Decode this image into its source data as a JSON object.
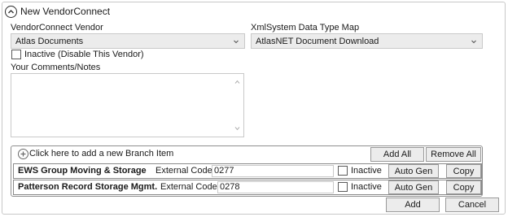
{
  "header": {
    "title": "New VendorConnect"
  },
  "vendor": {
    "label": "VendorConnect Vendor",
    "selected": "Atlas Documents"
  },
  "datatype": {
    "label": "XmlSystem Data Type Map",
    "selected": "AtlasNET Document Download"
  },
  "inactive": {
    "label": "Inactive (Disable This Vendor)",
    "checked": false
  },
  "comments": {
    "label": "Your Comments/Notes",
    "value": ""
  },
  "branches": {
    "add_text": "Click here to add a new Branch Item",
    "add_all": "Add All",
    "remove_all": "Remove All",
    "rows": [
      {
        "name": "EWS Group Moving & Storage",
        "ext_label": "External Code:",
        "ext_value": "0277",
        "inactive_label": "Inactive",
        "auto_gen": "Auto Gen",
        "copy": "Copy"
      },
      {
        "name": "Patterson Record Storage Mgmt.",
        "ext_label": "External Code:",
        "ext_value": "0278",
        "inactive_label": "Inactive",
        "auto_gen": "Auto Gen",
        "copy": "Copy"
      }
    ]
  },
  "footer": {
    "add": "Add",
    "cancel": "Cancel"
  }
}
